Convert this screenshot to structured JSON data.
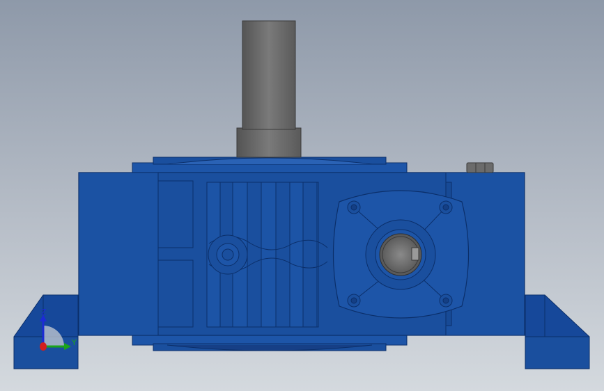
{
  "viewport": {
    "background_top": "#8e99a9",
    "background_bottom": "#d4d9de"
  },
  "model": {
    "body_color": "#1a4f9e",
    "body_dark": "#0f3a7e",
    "body_light": "#2a62b5",
    "shaft_color": "#6e6e6e",
    "shaft_dark": "#4f4f4f"
  },
  "triad": {
    "z_label": "Z",
    "y_label": "Y",
    "z_color": "#1c2bd6",
    "y_color": "#1aa41a",
    "x_color": "#d21e1e",
    "z_icon": "z-axis-arrow-icon",
    "y_icon": "y-axis-arrow-icon",
    "x_icon": "x-axis-dot-icon"
  }
}
